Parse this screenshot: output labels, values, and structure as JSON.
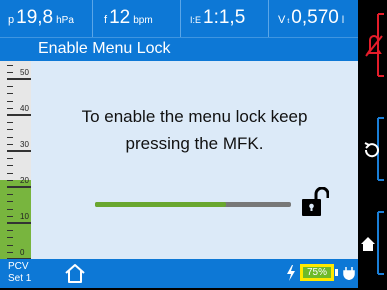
{
  "parameters": [
    {
      "symbol": "p",
      "value": "19,8",
      "unit": "hPa"
    },
    {
      "symbol": "f",
      "value": "12",
      "unit": "bpm"
    },
    {
      "symbol": "I:E",
      "value": "1:1,5",
      "unit": ""
    },
    {
      "symbol": "V",
      "value": "0,570",
      "unit": "l"
    }
  ],
  "title": "Enable Menu Lock",
  "message_line1": "To enable the menu lock keep",
  "message_line2": "pressing the MFK.",
  "progress_fraction": 0.67,
  "scale": {
    "labels": [
      "50",
      "40",
      "30",
      "20",
      "10",
      "0"
    ],
    "fill_level": 22,
    "max": 55
  },
  "mode": {
    "line1": "PCV",
    "line2": "Set 1"
  },
  "battery": {
    "percent": "75%"
  },
  "icons": {
    "lock": "unlocked-padlock-icon",
    "alarm": "alarm-off-icon",
    "back": "undo-icon",
    "home": "home-icon"
  },
  "colors": {
    "header": "#0d78d6",
    "panel": "#dceaf8",
    "accent_green": "#69a72f",
    "alarm_red": "#e41d2a"
  }
}
